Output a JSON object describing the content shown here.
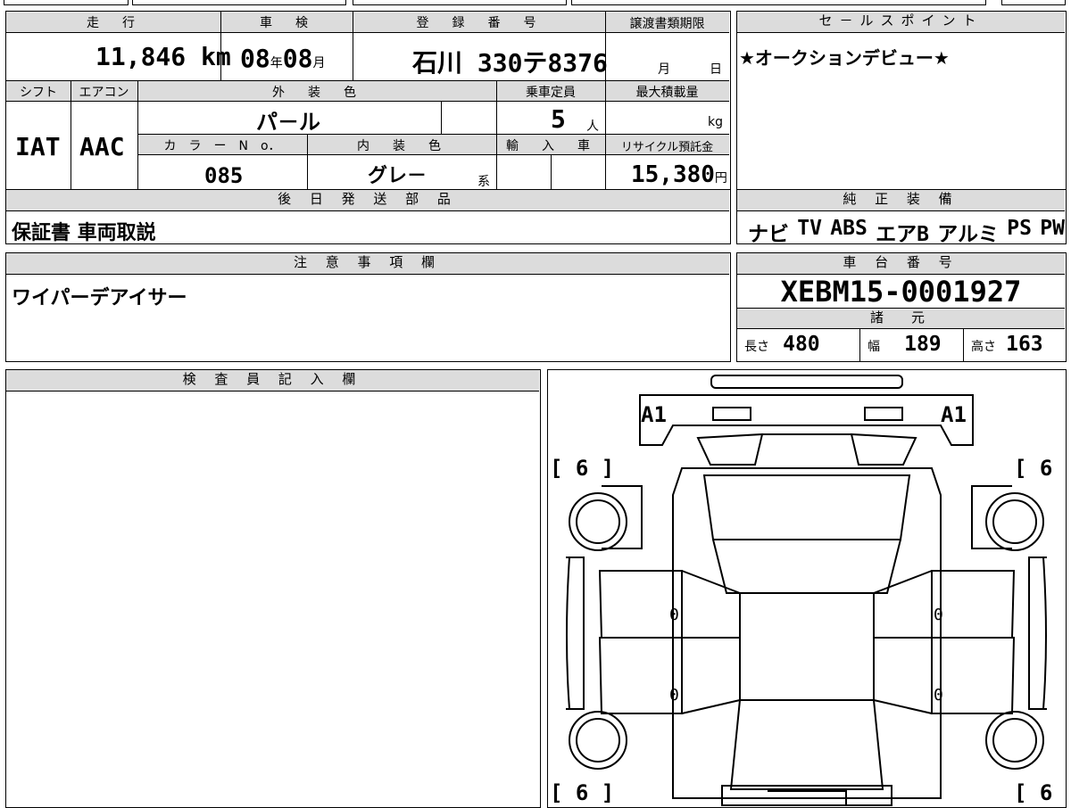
{
  "top_table": {
    "headers": {
      "mileage": "走　行",
      "inspection": "車　検",
      "registration": "登　録　番　号",
      "transfer_deadline": "譲渡書類期限",
      "shift": "シフト",
      "aircon": "エアコン",
      "exterior_color": "外　装　色",
      "capacity": "乗車定員",
      "max_load": "最大積載量",
      "color_no": "カ　ラ　ー　N　o．",
      "interior_color": "内　装　色",
      "import": "輸　入　車",
      "recycle_fee": "リサイクル預託金"
    },
    "mileage_value": "11,846",
    "mileage_unit": "km",
    "inspection_year": "08",
    "inspection_year_unit": "年",
    "inspection_month": "08",
    "inspection_month_unit": "月",
    "registration_value": "石川 330テ8376",
    "transfer_month_unit": "月",
    "transfer_day_unit": "日",
    "shift_value": "IAT",
    "aircon_value": "AAC",
    "exterior_color_value": "パ－ル",
    "capacity_value": "5",
    "capacity_unit": "人",
    "max_load_unit": "kg",
    "color_no_value": "085",
    "interior_color_value": "グレ－",
    "interior_color_suffix": "系",
    "recycle_fee_value": "15,380",
    "recycle_fee_unit": "円"
  },
  "sales_point": {
    "header": "セ－ルスポイント",
    "text": "★オークションデビュー★"
  },
  "later_parts": {
    "header": "後 日 発 送 部 品",
    "text": "保証書 車両取説"
  },
  "genuine_equipment": {
    "header": "純 正 装 備",
    "items": [
      "ナビ",
      "TV",
      "ABS",
      "エアB",
      "アルミ",
      "PS",
      "PW"
    ]
  },
  "notes": {
    "header": "注 意 事 項 欄",
    "text": "ワイパーデアイサー"
  },
  "chassis": {
    "header": "車 台 番 号",
    "value": "XEBM15-0001927"
  },
  "specs": {
    "header": "諸　元",
    "length_label": "長さ",
    "length_value": "480",
    "width_label": "幅",
    "width_value": "189",
    "height_label": "高さ",
    "height_value": "163"
  },
  "inspector": {
    "header": "検 査 員 記 入 欄"
  },
  "diagram": {
    "front_left_mark": "A1",
    "front_right_mark": "A1",
    "tire_fl": "[ 6 ]",
    "tire_fr": "[ 6 ]",
    "tire_rl": "[ 6 ]",
    "tire_rr": "[ 6 ]",
    "door_fl_mark": "0",
    "door_rl_mark": "0",
    "door_fr_mark": "0",
    "door_rr_mark": "0"
  }
}
